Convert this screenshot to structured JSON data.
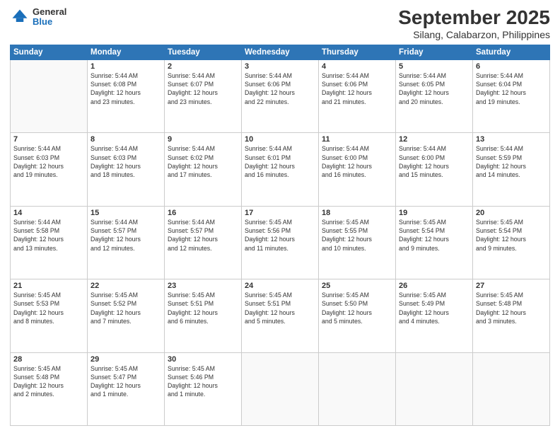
{
  "header": {
    "logo": {
      "general": "General",
      "blue": "Blue"
    },
    "title": "September 2025",
    "subtitle": "Silang, Calabarzon, Philippines"
  },
  "days_of_week": [
    "Sunday",
    "Monday",
    "Tuesday",
    "Wednesday",
    "Thursday",
    "Friday",
    "Saturday"
  ],
  "weeks": [
    [
      {
        "day": "",
        "sunrise": "",
        "sunset": "",
        "daylight": ""
      },
      {
        "day": "1",
        "sunrise": "5:44 AM",
        "sunset": "6:08 PM",
        "daylight": "12 hours and 23 minutes."
      },
      {
        "day": "2",
        "sunrise": "5:44 AM",
        "sunset": "6:07 PM",
        "daylight": "12 hours and 23 minutes."
      },
      {
        "day": "3",
        "sunrise": "5:44 AM",
        "sunset": "6:06 PM",
        "daylight": "12 hours and 22 minutes."
      },
      {
        "day": "4",
        "sunrise": "5:44 AM",
        "sunset": "6:06 PM",
        "daylight": "12 hours and 21 minutes."
      },
      {
        "day": "5",
        "sunrise": "5:44 AM",
        "sunset": "6:05 PM",
        "daylight": "12 hours and 20 minutes."
      },
      {
        "day": "6",
        "sunrise": "5:44 AM",
        "sunset": "6:04 PM",
        "daylight": "12 hours and 19 minutes."
      }
    ],
    [
      {
        "day": "7",
        "sunrise": "5:44 AM",
        "sunset": "6:03 PM",
        "daylight": "12 hours and 19 minutes."
      },
      {
        "day": "8",
        "sunrise": "5:44 AM",
        "sunset": "6:03 PM",
        "daylight": "12 hours and 18 minutes."
      },
      {
        "day": "9",
        "sunrise": "5:44 AM",
        "sunset": "6:02 PM",
        "daylight": "12 hours and 17 minutes."
      },
      {
        "day": "10",
        "sunrise": "5:44 AM",
        "sunset": "6:01 PM",
        "daylight": "12 hours and 16 minutes."
      },
      {
        "day": "11",
        "sunrise": "5:44 AM",
        "sunset": "6:00 PM",
        "daylight": "12 hours and 16 minutes."
      },
      {
        "day": "12",
        "sunrise": "5:44 AM",
        "sunset": "6:00 PM",
        "daylight": "12 hours and 15 minutes."
      },
      {
        "day": "13",
        "sunrise": "5:44 AM",
        "sunset": "5:59 PM",
        "daylight": "12 hours and 14 minutes."
      }
    ],
    [
      {
        "day": "14",
        "sunrise": "5:44 AM",
        "sunset": "5:58 PM",
        "daylight": "12 hours and 13 minutes."
      },
      {
        "day": "15",
        "sunrise": "5:44 AM",
        "sunset": "5:57 PM",
        "daylight": "12 hours and 12 minutes."
      },
      {
        "day": "16",
        "sunrise": "5:44 AM",
        "sunset": "5:57 PM",
        "daylight": "12 hours and 12 minutes."
      },
      {
        "day": "17",
        "sunrise": "5:45 AM",
        "sunset": "5:56 PM",
        "daylight": "12 hours and 11 minutes."
      },
      {
        "day": "18",
        "sunrise": "5:45 AM",
        "sunset": "5:55 PM",
        "daylight": "12 hours and 10 minutes."
      },
      {
        "day": "19",
        "sunrise": "5:45 AM",
        "sunset": "5:54 PM",
        "daylight": "12 hours and 9 minutes."
      },
      {
        "day": "20",
        "sunrise": "5:45 AM",
        "sunset": "5:54 PM",
        "daylight": "12 hours and 9 minutes."
      }
    ],
    [
      {
        "day": "21",
        "sunrise": "5:45 AM",
        "sunset": "5:53 PM",
        "daylight": "12 hours and 8 minutes."
      },
      {
        "day": "22",
        "sunrise": "5:45 AM",
        "sunset": "5:52 PM",
        "daylight": "12 hours and 7 minutes."
      },
      {
        "day": "23",
        "sunrise": "5:45 AM",
        "sunset": "5:51 PM",
        "daylight": "12 hours and 6 minutes."
      },
      {
        "day": "24",
        "sunrise": "5:45 AM",
        "sunset": "5:51 PM",
        "daylight": "12 hours and 5 minutes."
      },
      {
        "day": "25",
        "sunrise": "5:45 AM",
        "sunset": "5:50 PM",
        "daylight": "12 hours and 5 minutes."
      },
      {
        "day": "26",
        "sunrise": "5:45 AM",
        "sunset": "5:49 PM",
        "daylight": "12 hours and 4 minutes."
      },
      {
        "day": "27",
        "sunrise": "5:45 AM",
        "sunset": "5:48 PM",
        "daylight": "12 hours and 3 minutes."
      }
    ],
    [
      {
        "day": "28",
        "sunrise": "5:45 AM",
        "sunset": "5:48 PM",
        "daylight": "12 hours and 2 minutes."
      },
      {
        "day": "29",
        "sunrise": "5:45 AM",
        "sunset": "5:47 PM",
        "daylight": "12 hours and 1 minute."
      },
      {
        "day": "30",
        "sunrise": "5:45 AM",
        "sunset": "5:46 PM",
        "daylight": "12 hours and 1 minute."
      },
      {
        "day": "",
        "sunrise": "",
        "sunset": "",
        "daylight": ""
      },
      {
        "day": "",
        "sunrise": "",
        "sunset": "",
        "daylight": ""
      },
      {
        "day": "",
        "sunrise": "",
        "sunset": "",
        "daylight": ""
      },
      {
        "day": "",
        "sunrise": "",
        "sunset": "",
        "daylight": ""
      }
    ]
  ]
}
